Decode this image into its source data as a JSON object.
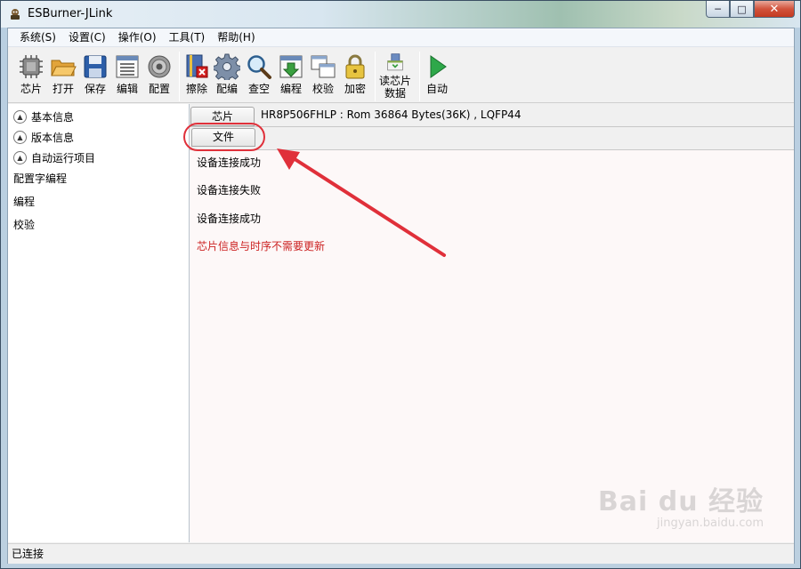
{
  "window": {
    "title": "ESBurner-JLink",
    "minimize": "─",
    "maximize": "□",
    "close": "✕"
  },
  "menu": [
    {
      "label": "系统(S)"
    },
    {
      "label": "设置(C)"
    },
    {
      "label": "操作(O)"
    },
    {
      "label": "工具(T)"
    },
    {
      "label": "帮助(H)"
    }
  ],
  "toolbar": {
    "chip": "芯片",
    "open": "打开",
    "save": "保存",
    "edit": "编辑",
    "config": "配置",
    "erase": "擦除",
    "config_edit": "配编",
    "blank_check": "查空",
    "program": "编程",
    "verify": "校验",
    "encrypt": "加密",
    "read_chip_line1": "读芯片",
    "read_chip_line2": "数据",
    "auto": "自动"
  },
  "sidebar": {
    "items": [
      {
        "label": "基本信息"
      },
      {
        "label": "版本信息"
      },
      {
        "label": "自动运行项目"
      },
      {
        "label": "配置字编程"
      },
      {
        "label": "编程"
      },
      {
        "label": "校验"
      }
    ]
  },
  "main": {
    "tab_chip": "芯片",
    "tab_file": "文件",
    "chip_info": "HR8P506FHLP : Rom 36864 Bytes(36K) , LQFP44",
    "log": [
      {
        "text": "设备连接成功"
      },
      {
        "text": "设备连接失败"
      },
      {
        "text": "设备连接成功"
      },
      {
        "text": "芯片信息与时序不需要更新"
      }
    ]
  },
  "watermark": {
    "main": "Bai du 经验",
    "sub": "jingyan.baidu.com"
  },
  "status": {
    "text": "已连接"
  },
  "colors": {
    "annotation": "#e0303a",
    "log_warning": "#cc2222"
  }
}
